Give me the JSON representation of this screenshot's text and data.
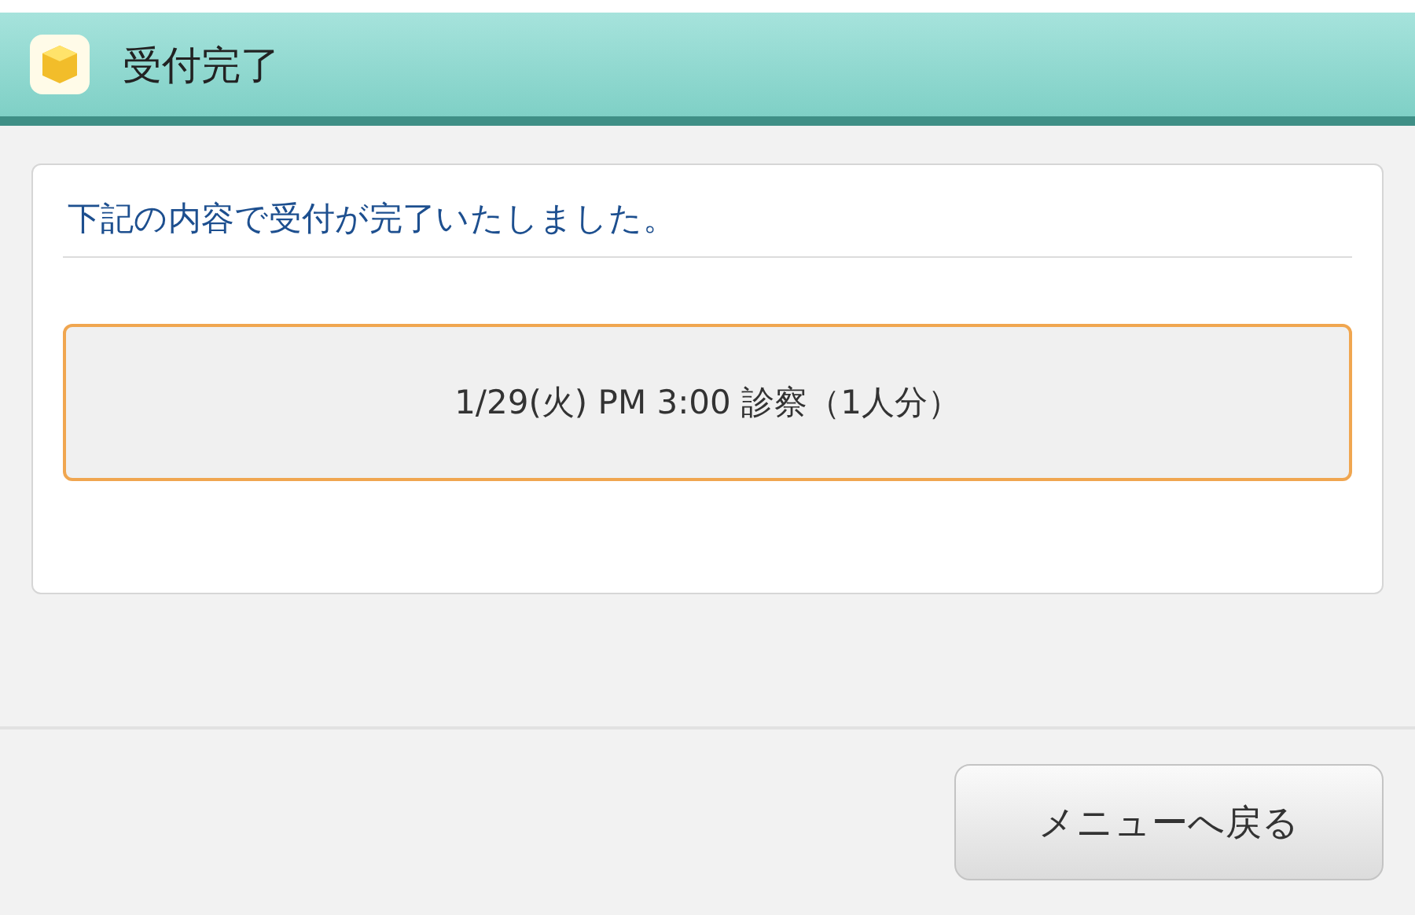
{
  "window": {
    "title": "受付完了"
  },
  "message": "下記の内容で受付が完了いたしました。",
  "reservation": "1/29(火) PM 3:00 診察（1人分）",
  "buttons": [
    "メニューへ戻る"
  ]
}
